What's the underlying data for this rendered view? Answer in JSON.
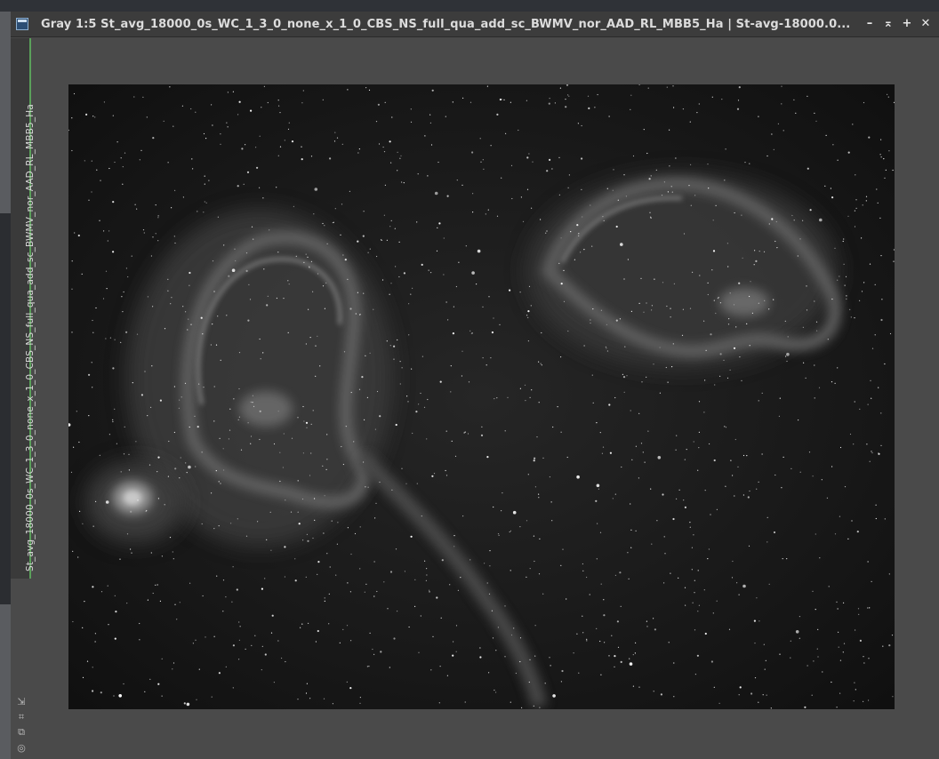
{
  "window": {
    "title": "Gray 1:5 St_avg_18000_0s_WC_1_3_0_none_x_1_0_CBS_NS_full_qua_add_sc_BWMV_nor_AAD_RL_MBB5_Ha | St-avg-18000.0...",
    "side_tab_label": "St_avg_18000_0s_WC_1_3_0_none_x_1_0_CBS_NS_full_qua_add_sc_BWMV_nor_AAD_RL_MBB5_Ha",
    "controls": {
      "minimize": "–",
      "shade": "⌅",
      "maximize": "+",
      "close": "✕"
    },
    "bottom_tools": [
      {
        "icon": "shrink-arrow-icon",
        "glyph": "⇲"
      },
      {
        "icon": "fit-view-icon",
        "glyph": "⌗"
      },
      {
        "icon": "clone-view-icon",
        "glyph": "⧉"
      },
      {
        "icon": "stf-icon",
        "glyph": "◎"
      }
    ]
  },
  "image": {
    "description_hidden": "",
    "colors": {
      "sky": "#141414",
      "nebula": "#8a8a8a",
      "star": "#ffffff"
    }
  }
}
